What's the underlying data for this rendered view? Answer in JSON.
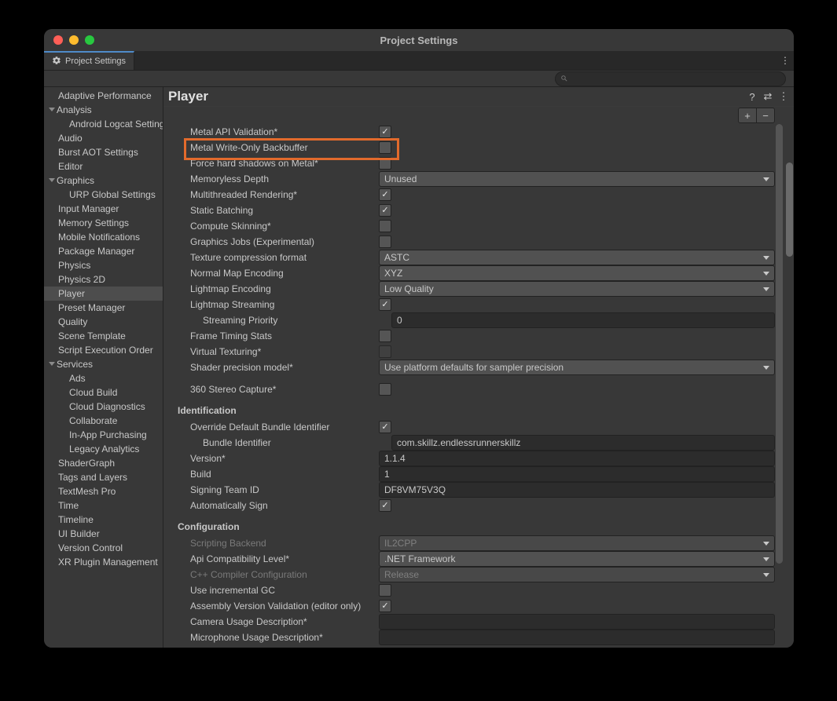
{
  "window": {
    "title": "Project Settings"
  },
  "tab": {
    "label": "Project Settings"
  },
  "sidebar": {
    "items": [
      {
        "label": "Adaptive Performance",
        "child": false
      },
      {
        "label": "Analysis",
        "child": false,
        "expandable": true
      },
      {
        "label": "Android Logcat Settings",
        "child": true
      },
      {
        "label": "Audio",
        "child": false
      },
      {
        "label": "Burst AOT Settings",
        "child": false
      },
      {
        "label": "Editor",
        "child": false
      },
      {
        "label": "Graphics",
        "child": false,
        "expandable": true
      },
      {
        "label": "URP Global Settings",
        "child": true
      },
      {
        "label": "Input Manager",
        "child": false
      },
      {
        "label": "Memory Settings",
        "child": false
      },
      {
        "label": "Mobile Notifications",
        "child": false
      },
      {
        "label": "Package Manager",
        "child": false
      },
      {
        "label": "Physics",
        "child": false
      },
      {
        "label": "Physics 2D",
        "child": false
      },
      {
        "label": "Player",
        "child": false,
        "selected": true
      },
      {
        "label": "Preset Manager",
        "child": false
      },
      {
        "label": "Quality",
        "child": false
      },
      {
        "label": "Scene Template",
        "child": false
      },
      {
        "label": "Script Execution Order",
        "child": false
      },
      {
        "label": "Services",
        "child": false,
        "expandable": true
      },
      {
        "label": "Ads",
        "child": true
      },
      {
        "label": "Cloud Build",
        "child": true
      },
      {
        "label": "Cloud Diagnostics",
        "child": true
      },
      {
        "label": "Collaborate",
        "child": true
      },
      {
        "label": "In-App Purchasing",
        "child": true
      },
      {
        "label": "Legacy Analytics",
        "child": true
      },
      {
        "label": "ShaderGraph",
        "child": false
      },
      {
        "label": "Tags and Layers",
        "child": false
      },
      {
        "label": "TextMesh Pro",
        "child": false
      },
      {
        "label": "Time",
        "child": false
      },
      {
        "label": "Timeline",
        "child": false
      },
      {
        "label": "UI Builder",
        "child": false
      },
      {
        "label": "Version Control",
        "child": false
      },
      {
        "label": "XR Plugin Management",
        "child": false
      }
    ]
  },
  "content": {
    "title": "Player",
    "rows": [
      {
        "label": "Metal API Validation*",
        "type": "check",
        "checked": true
      },
      {
        "label": "Metal Write-Only Backbuffer",
        "type": "check",
        "checked": false,
        "highlight": true
      },
      {
        "label": "Force hard shadows on Metal*",
        "type": "check",
        "checked": false
      },
      {
        "label": "Memoryless Depth",
        "type": "dropdown",
        "value": "Unused"
      },
      {
        "label": "Multithreaded Rendering*",
        "type": "check",
        "checked": true
      },
      {
        "label": "Static Batching",
        "type": "check",
        "checked": true
      },
      {
        "label": "Compute Skinning*",
        "type": "check",
        "checked": false
      },
      {
        "label": "Graphics Jobs (Experimental)",
        "type": "check",
        "checked": false
      },
      {
        "label": "Texture compression format",
        "type": "dropdown",
        "value": "ASTC"
      },
      {
        "label": "Normal Map Encoding",
        "type": "dropdown",
        "value": "XYZ"
      },
      {
        "label": "Lightmap Encoding",
        "type": "dropdown",
        "value": "Low Quality"
      },
      {
        "label": "Lightmap Streaming",
        "type": "check",
        "checked": true
      },
      {
        "label": "Streaming Priority",
        "type": "text",
        "value": "0",
        "indent": true
      },
      {
        "label": "Frame Timing Stats",
        "type": "check",
        "checked": false
      },
      {
        "label": "Virtual Texturing*",
        "type": "check",
        "checked": false,
        "disabledCtrl": true
      },
      {
        "label": "Shader precision model*",
        "type": "dropdown",
        "value": "Use platform defaults for sampler precision"
      },
      {
        "type": "spacer"
      },
      {
        "label": "360 Stereo Capture*",
        "type": "check",
        "checked": false
      },
      {
        "type": "section",
        "label": "Identification"
      },
      {
        "label": "Override Default Bundle Identifier",
        "type": "check",
        "checked": true
      },
      {
        "label": "Bundle Identifier",
        "type": "text",
        "value": "com.skillz.endlessrunnerskillz",
        "indent": true
      },
      {
        "label": "Version*",
        "type": "text",
        "value": "1.1.4"
      },
      {
        "label": "Build",
        "type": "text",
        "value": "1"
      },
      {
        "label": "Signing Team ID",
        "type": "text",
        "value": "DF8VM75V3Q"
      },
      {
        "label": "Automatically Sign",
        "type": "check",
        "checked": true
      },
      {
        "type": "section",
        "label": "Configuration"
      },
      {
        "label": "Scripting Backend",
        "type": "dropdown",
        "value": "IL2CPP",
        "disabled": true
      },
      {
        "label": "Api Compatibility Level*",
        "type": "dropdown",
        "value": ".NET Framework"
      },
      {
        "label": "C++ Compiler Configuration",
        "type": "dropdown",
        "value": "Release",
        "disabled": true
      },
      {
        "label": "Use incremental GC",
        "type": "check",
        "checked": false
      },
      {
        "label": "Assembly Version Validation (editor only)",
        "type": "check",
        "checked": true
      },
      {
        "label": "Camera Usage Description*",
        "type": "text",
        "value": ""
      },
      {
        "label": "Microphone Usage Description*",
        "type": "text",
        "value": ""
      }
    ]
  }
}
